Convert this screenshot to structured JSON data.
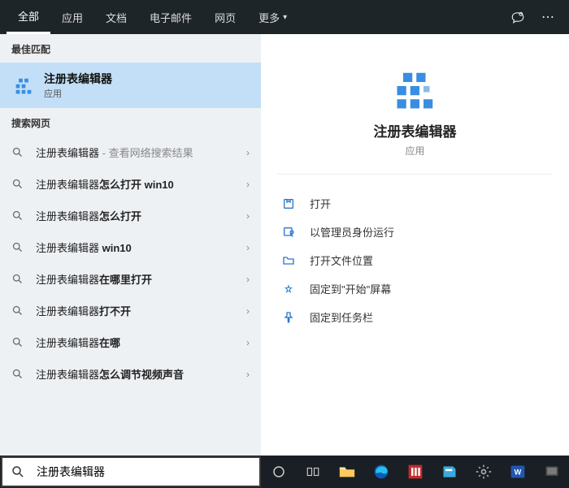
{
  "tabs": {
    "all": "全部",
    "apps": "应用",
    "docs": "文档",
    "mail": "电子邮件",
    "web": "网页",
    "more": "更多"
  },
  "sections": {
    "best_match": "最佳匹配",
    "search_web": "搜索网页"
  },
  "best_match": {
    "title": "注册表编辑器",
    "subtitle": "应用"
  },
  "web_results": [
    {
      "prefix": "注册表编辑器",
      "suffix": " - 查看网络搜索结果",
      "bold": false
    },
    {
      "prefix": "注册表编辑器",
      "suffix": "怎么打开 win10",
      "bold": true
    },
    {
      "prefix": "注册表编辑器",
      "suffix": "怎么打开",
      "bold": true
    },
    {
      "prefix": "注册表编辑器",
      "suffix": " win10",
      "bold": true
    },
    {
      "prefix": "注册表编辑器",
      "suffix": "在哪里打开",
      "bold": true
    },
    {
      "prefix": "注册表编辑器",
      "suffix": "打不开",
      "bold": true
    },
    {
      "prefix": "注册表编辑器",
      "suffix": "在哪",
      "bold": true
    },
    {
      "prefix": "注册表编辑器",
      "suffix": "怎么调节视频声音",
      "bold": true
    }
  ],
  "detail": {
    "title": "注册表编辑器",
    "subtitle": "应用",
    "actions": {
      "open": "打开",
      "admin": "以管理员身份运行",
      "location": "打开文件位置",
      "pin_start": "固定到\"开始\"屏幕",
      "pin_taskbar": "固定到任务栏"
    }
  },
  "search": {
    "value": "注册表编辑器"
  }
}
